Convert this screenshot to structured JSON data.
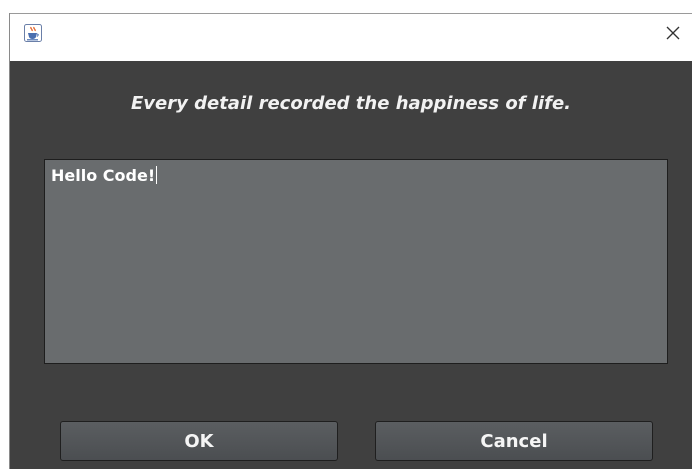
{
  "dialog": {
    "app_icon": "java-cup-icon",
    "close_icon": "close-icon",
    "message": "Every detail recorded the happiness of life.",
    "text_value": "Hello Code!"
  },
  "buttons": {
    "ok_label": "OK",
    "cancel_label": "Cancel"
  },
  "colors": {
    "background": "#404040",
    "textarea_background": "#696c6e",
    "button_background": "#55585b",
    "text": "#f2f2f2"
  }
}
